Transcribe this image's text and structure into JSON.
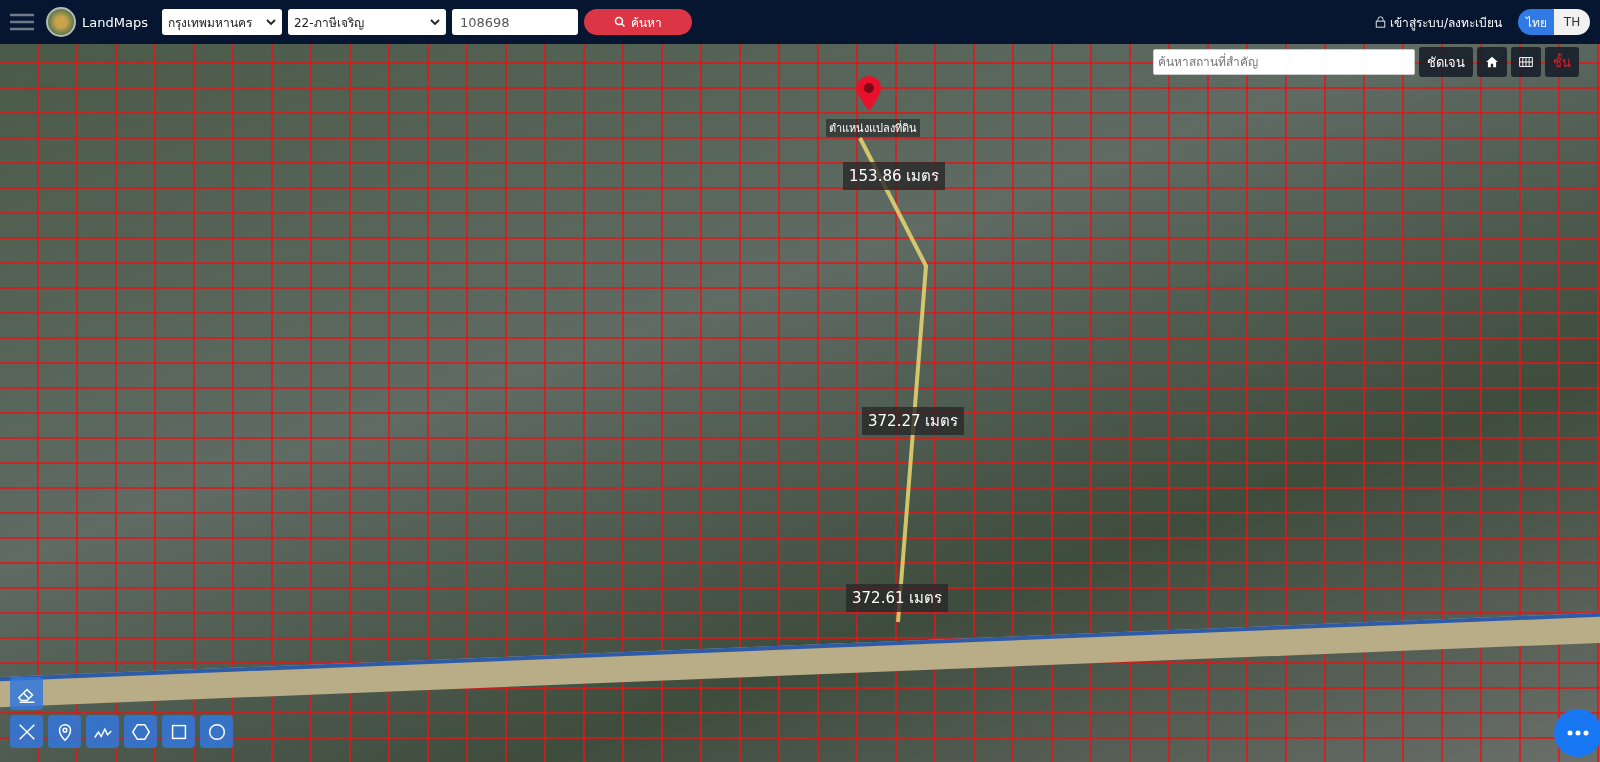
{
  "header": {
    "logo_text": "LandMaps",
    "province": "กรุงเทพมหานคร",
    "district": "22-ภาษีเจริญ",
    "parcel_number": "108698",
    "search_button": "ค้นหา",
    "login": "เข้าสู่ระบบ/ลงทะเบียน",
    "languages": [
      {
        "label": "ไทย",
        "selected": true
      },
      {
        "label": "TH",
        "selected": false
      }
    ]
  },
  "map": {
    "place_search": {
      "placeholder": "ค้นหาสถานที่สำคัญ"
    },
    "clear_button": "ชัดเจน",
    "layers_button": "ชั้น",
    "marker_label": "ตำแหน่งแปลงที่ดิน",
    "measurements": [
      "153.86 เมตร",
      "372.27 เมตร",
      "372.61 เมตร"
    ],
    "tools": [
      {
        "kind": "eraser"
      },
      {
        "kind": "ruler"
      },
      {
        "kind": "point"
      },
      {
        "kind": "line"
      },
      {
        "kind": "polygon"
      },
      {
        "kind": "rectangle"
      },
      {
        "kind": "circle"
      }
    ]
  }
}
